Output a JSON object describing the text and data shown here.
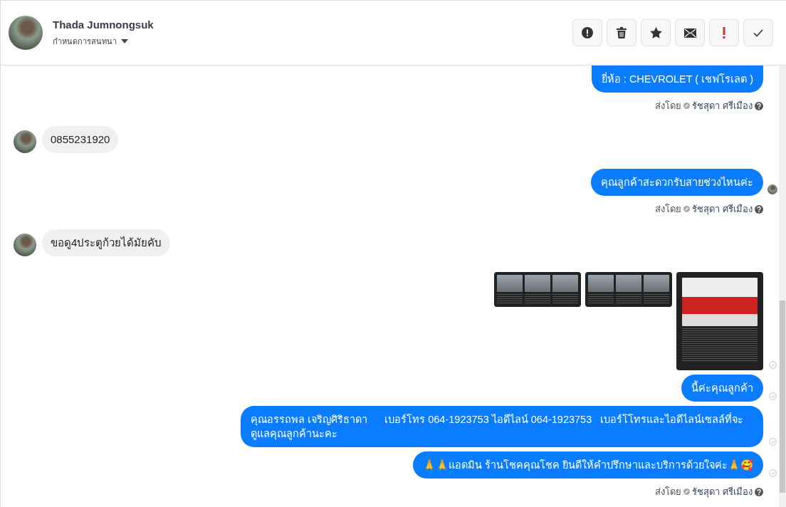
{
  "header": {
    "name": "Thada Jumnongsuk",
    "subtitle": "กำหนดการสนทนา",
    "actions": [
      {
        "kind": "alert"
      },
      {
        "kind": "trash"
      },
      {
        "kind": "star"
      },
      {
        "kind": "mail"
      },
      {
        "kind": "important"
      },
      {
        "kind": "done"
      }
    ]
  },
  "messages": [
    {
      "kind": "outgoing",
      "text": "ยี่ห้อ : CHEVROLET ( เชฟโรเลต )",
      "seen": false,
      "sent": false
    },
    {
      "kind": "meta",
      "label": "ส่งโดย",
      "sender": "รัชสุดา ศรีเมือง"
    },
    {
      "kind": "incoming",
      "text": "0855231920"
    },
    {
      "kind": "outgoing",
      "text": "คุณลูกค้าสะดวกรับสายช่วงไหนค่ะ",
      "seen": true,
      "sent": false
    },
    {
      "kind": "meta",
      "label": "ส่งโดย",
      "sender": "รัชสุดา ศรีเมือง"
    },
    {
      "kind": "incoming",
      "text": "ขอดู4ประตูก้วยได้มัยคับ"
    },
    {
      "kind": "images",
      "images": [
        {
          "kind": "collage"
        },
        {
          "kind": "collage"
        },
        {
          "kind": "single"
        }
      ],
      "seen": false,
      "sent": true
    },
    {
      "kind": "outgoing",
      "text": "นี้ค่ะคุณลูกค้า",
      "seen": false,
      "sent": true
    },
    {
      "kind": "outgoing",
      "text": "คุณอรรถพล เจริญศิริธาดา      เบอร์โทร 064-1923753 ไอดีไลน์ 064-1923753   เบอร์โโทรและไอดีไลน์เซลล์ที่จะดูแลคุณลูกค้านะคะ",
      "seen": false,
      "sent": true
    },
    {
      "kind": "outgoing",
      "text": "🙏🙏แอดมิน ร้านโชคคุณโชค ยินดีให้คำปรึกษาและบริการด้วยใจค่ะ🙏🥰",
      "seen": false,
      "sent": true
    },
    {
      "kind": "meta",
      "label": "ส่งโดย",
      "sender": "รัชสุดา ศรีเมือง"
    }
  ]
}
